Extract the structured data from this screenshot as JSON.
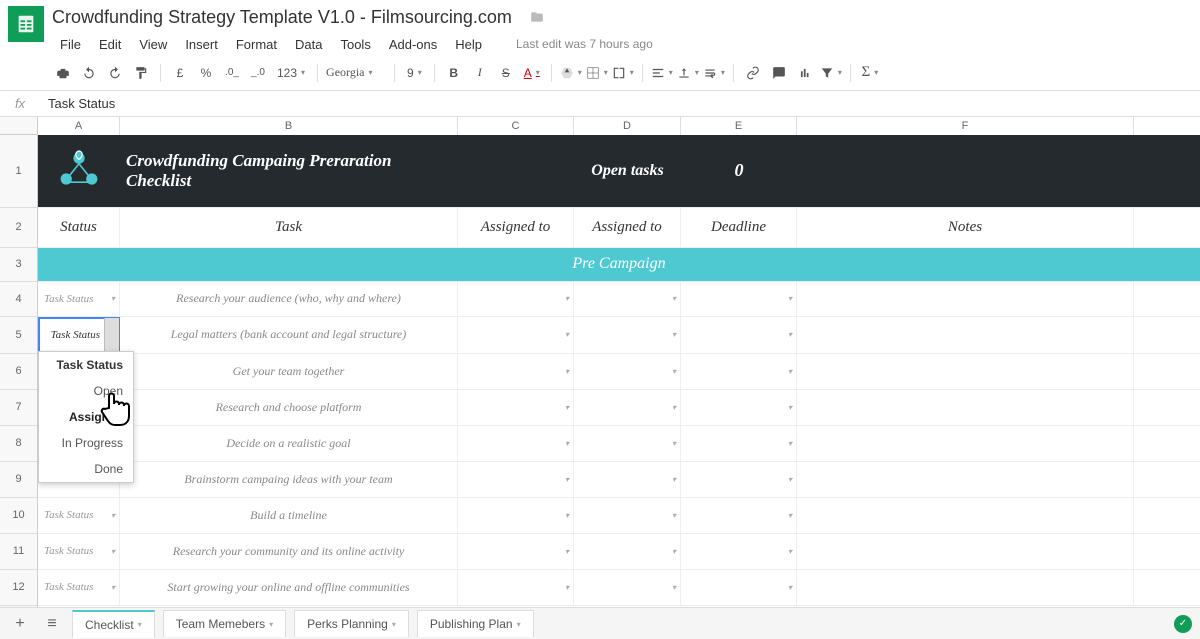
{
  "doc_title": "Crowdfunding Strategy Template V1.0 - Filmsourcing.com",
  "edit_info": "Last edit was 7 hours ago",
  "menus": [
    "File",
    "Edit",
    "View",
    "Insert",
    "Format",
    "Data",
    "Tools",
    "Add-ons",
    "Help"
  ],
  "toolbar": {
    "currency": "£",
    "percent": "%",
    "dec_dec": ".0_",
    "dec_inc": "_.0",
    "num_format": "123",
    "font": "Georgia",
    "size": "9",
    "bold": "B",
    "italic": "I",
    "strike": "S",
    "underline": "A"
  },
  "fx_value": "Task Status",
  "columns": [
    "A",
    "B",
    "C",
    "D",
    "E",
    "F"
  ],
  "row_nums": [
    "1",
    "2",
    "3",
    "4",
    "5",
    "6",
    "7",
    "8",
    "9",
    "10",
    "11",
    "12"
  ],
  "banner": {
    "title": "Crowdfunding Campaing Preraration Checklist",
    "open_tasks_label": "Open tasks",
    "open_tasks_count": "0"
  },
  "headers": {
    "status": "Status",
    "task": "Task",
    "assigned_to": "Assigned to",
    "assigned_to2": "Assigned to",
    "deadline": "Deadline",
    "notes": "Notes"
  },
  "section": "Pre Campaign",
  "tasks": [
    "Research your audience (who, why and where)",
    "Legal matters (bank account and legal structure)",
    "Get your team together",
    "Research and choose platform",
    "Decide on a realistic goal",
    "Brainstorm campaing ideas with your team",
    "Build a timeline",
    "Research your community and its online activity",
    "Start growing your online and offline communities"
  ],
  "status_placeholder": "Task Status",
  "active_cell_value": "Task Status",
  "dropdown_options": [
    "Task Status",
    "Open",
    "Assigned",
    "In Progress",
    "Done"
  ],
  "sheets": [
    "Checklist",
    "Team Memebers",
    "Perks Planning",
    "Publishing Plan"
  ]
}
